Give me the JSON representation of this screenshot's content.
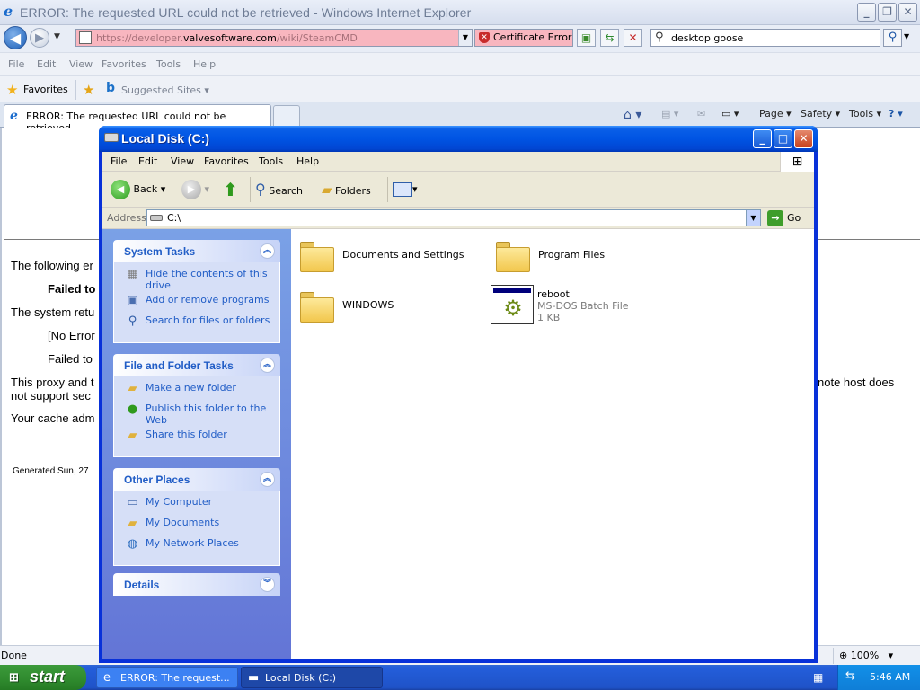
{
  "ie": {
    "title": "ERROR: The requested URL could not be retrieved - Windows Internet Explorer",
    "address": {
      "url_prefix": "https://developer.",
      "url_domain": "valvesoftware.com",
      "url_suffix": "/wiki/SteamCMD",
      "cert_error": "Certificate Error"
    },
    "search": {
      "value": "desktop goose"
    },
    "menu": [
      "File",
      "Edit",
      "View",
      "Favorites",
      "Tools",
      "Help"
    ],
    "favorites": {
      "label": "Favorites",
      "suggested": "Suggested Sites"
    },
    "tab": {
      "label": "ERROR: The requested URL could not be retrieved"
    },
    "command_bar": {
      "page": "Page",
      "safety": "Safety",
      "tools": "Tools"
    },
    "content": {
      "line1": "The following er",
      "line2": "Failed to",
      "line3": "The system retu",
      "line4": "[No Error",
      "line5": "Failed to",
      "line6a": "This proxy and t",
      "line6b": "not support sec",
      "line6_right": "note host does",
      "line7": "Your cache adm",
      "generated": "Generated Sun, 27"
    },
    "status": {
      "text": "Done",
      "zoom": "100%"
    }
  },
  "explorer": {
    "title": "Local Disk (C:)",
    "menu": [
      "File",
      "Edit",
      "View",
      "Favorites",
      "Tools",
      "Help"
    ],
    "toolbar": {
      "back": "Back",
      "search": "Search",
      "folders": "Folders"
    },
    "address": {
      "label": "Address",
      "value": "C:\\",
      "go": "Go"
    },
    "panels": {
      "system_tasks": {
        "title": "System Tasks",
        "items": [
          "Hide the contents of this drive",
          "Add or remove programs",
          "Search for files or folders"
        ]
      },
      "file_folder_tasks": {
        "title": "File and Folder Tasks",
        "items": [
          "Make a new folder",
          "Publish this folder to the Web",
          "Share this folder"
        ]
      },
      "other_places": {
        "title": "Other Places",
        "items": [
          "My Computer",
          "My Documents",
          "My Network Places"
        ]
      },
      "details": {
        "title": "Details"
      }
    },
    "files": [
      {
        "name": "Documents and Settings",
        "type": "folder"
      },
      {
        "name": "Program Files",
        "type": "folder"
      },
      {
        "name": "WINDOWS",
        "type": "folder"
      },
      {
        "name": "reboot",
        "type": "batch",
        "desc": "MS-DOS Batch File",
        "size": "1 KB"
      }
    ]
  },
  "taskbar": {
    "start": "start",
    "buttons": [
      "ERROR: The request...",
      "Local Disk (C:)"
    ],
    "clock": "5:46 AM"
  },
  "colors": {
    "xp_blue": "#0054e3",
    "task_link": "#215dc6",
    "cert_error_bg": "#f8b6bf",
    "start_green": "#2f8a2e"
  }
}
